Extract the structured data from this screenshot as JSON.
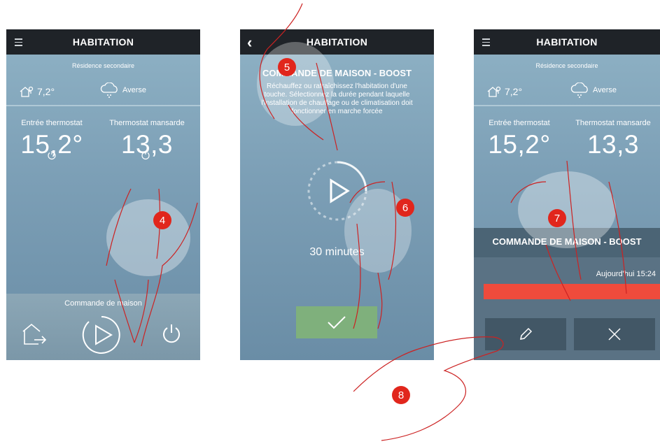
{
  "screens": {
    "home_left": {
      "title": "HABITATION",
      "residence": "Résidence secondaire",
      "outdoor_temp": "7,2°",
      "weather": "Averse",
      "zones": [
        {
          "name": "Entrée thermostat",
          "value": "15,2°"
        },
        {
          "name": "Thermostat mansarde",
          "value": "13,3"
        }
      ],
      "bottom_label": "Commande de maison"
    },
    "boost": {
      "title": "HABITATION",
      "overlay_title": "COMMANDE DE MAISON - BOOST",
      "description": "Réchauffez ou rafraîchissez l'habitation d'une touche. Sélectionnez la durée pendant laquelle l'installation de chauffage ou de climatisation doit fonctionner en marche forcée",
      "duration": "30 minutes"
    },
    "home_right": {
      "title": "HABITATION",
      "residence": "Résidence secondaire",
      "outdoor_temp": "7,2°",
      "weather": "Averse",
      "zones": [
        {
          "name": "Entrée thermostat",
          "value": "15,2°"
        },
        {
          "name": "Thermostat mansarde",
          "value": "13,3"
        }
      ],
      "banner_title": "COMMANDE DE MAISON - BOOST",
      "until_time": "Aujourd'hui 15:24"
    }
  },
  "steps": [
    "4",
    "5",
    "6",
    "7",
    "8"
  ],
  "icons": {
    "menu": "hamburger-icon",
    "back": "back-chevron-icon",
    "house": "house-temp-icon",
    "cloud": "rain-cloud-icon",
    "power": "power-icon",
    "exit": "exit-house-icon",
    "play": "play-circle-icon",
    "check": "check-icon",
    "edit": "pencil-icon",
    "close": "close-x-icon"
  },
  "colors": {
    "accent_red": "#e1261c",
    "boost_bar": "#ef4b3c",
    "confirm_green": "#7fb07c",
    "topbar": "#1f2328"
  }
}
